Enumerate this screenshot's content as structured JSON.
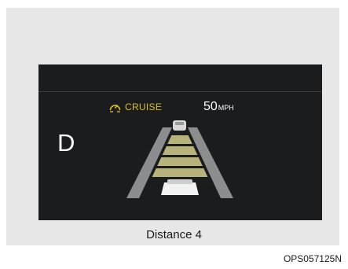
{
  "cluster": {
    "gear": "D",
    "cruise_label": "CRUISE",
    "speed_value": "50",
    "speed_unit": "MPH",
    "cruise_icon": "speedometer-icon",
    "distance_bars_active": 4,
    "colors": {
      "screen_bg": "#1b1c1d",
      "accent": "#d9c21a",
      "bar_fill": "#b7b37a",
      "road_edge": "#8c8d8f"
    }
  },
  "caption": "Distance 4",
  "figure_code": "OPS057125N"
}
